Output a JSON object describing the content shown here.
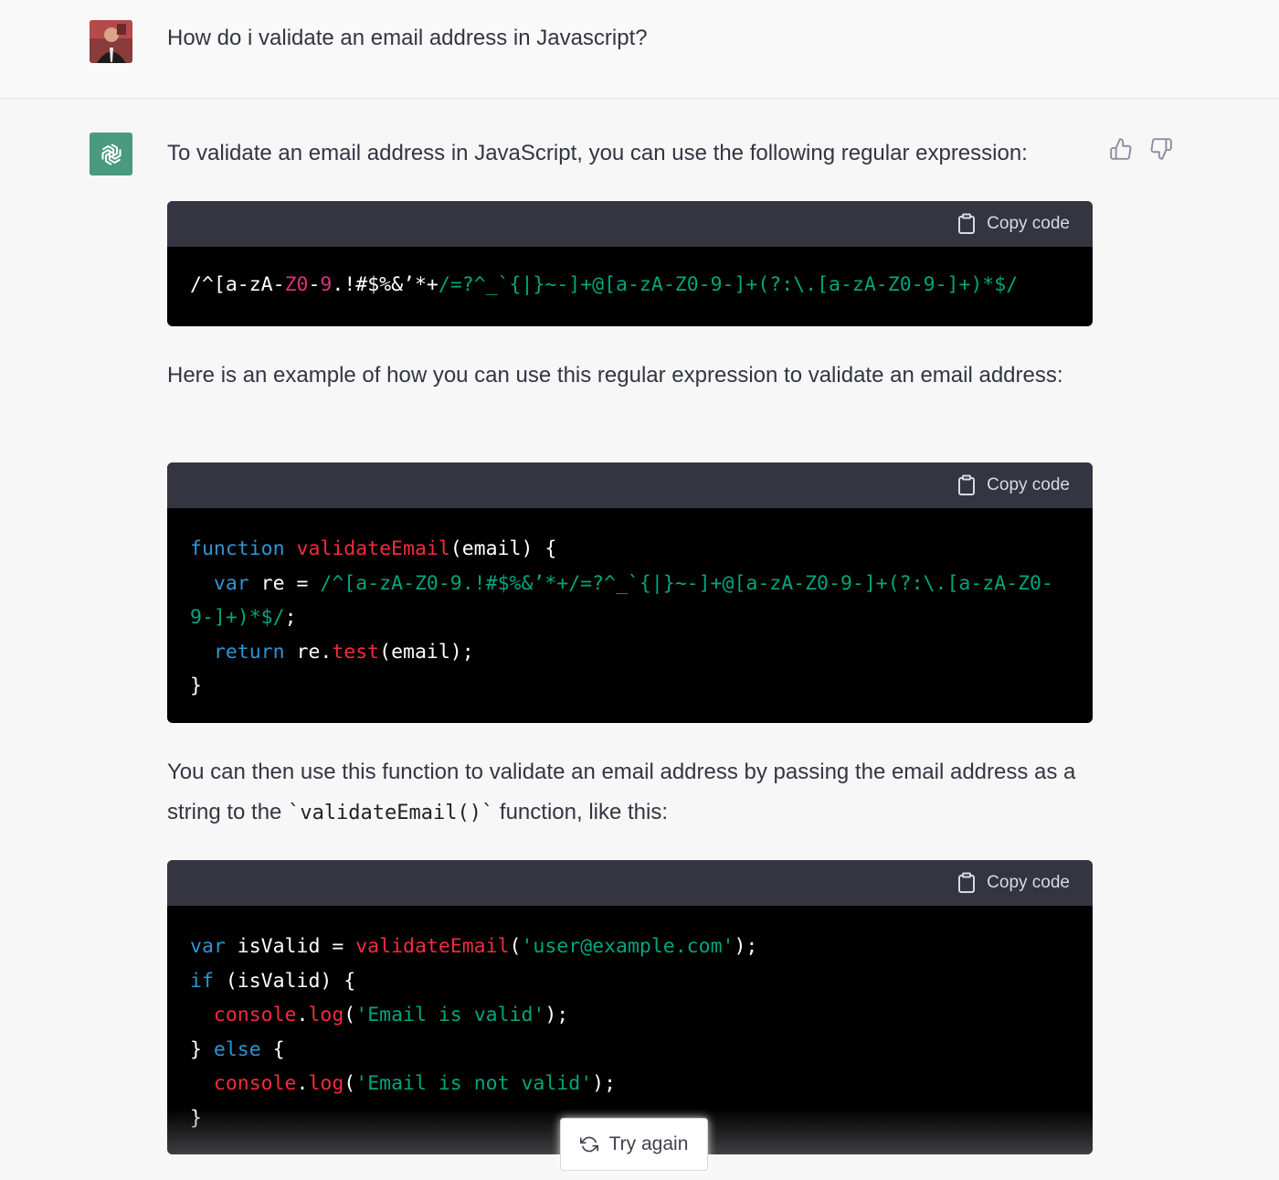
{
  "user_message": "How do i validate an email address in Javascript?",
  "assistant": {
    "intro": "To validate an email address in JavaScript, you can use the following regular expression:",
    "example_intro": "Here is an example of how you can use this regular expression to validate an email address:",
    "usage_intro_before": "You can then use this function to validate an email address by passing the email address as a string to the ",
    "usage_inline_code": "`validateEmail()`",
    "usage_intro_after": " function, like this:",
    "copy_label": "Copy code",
    "code_blocks": {
      "regex": {
        "lines": [
          [
            [
              "/^[a-zA-",
              "plain"
            ],
            [
              "Z0",
              "red"
            ],
            [
              "-",
              "plain"
            ],
            [
              "9",
              "red"
            ],
            [
              ".",
              "plain"
            ],
            [
              "!#$%&’*+",
              "plain"
            ],
            [
              "/=?^_`{|}~-]+@[a-zA-Z0-9-]+(?:\\.[a-zA-Z0-9-]+)*$/",
              "str"
            ]
          ]
        ]
      },
      "function": {
        "lines": [
          [
            [
              "function ",
              "kw"
            ],
            [
              "validateEmail",
              "fn"
            ],
            [
              "(email) {",
              "plain"
            ]
          ],
          [
            [
              "  var ",
              "kw"
            ],
            [
              "re = ",
              "plain"
            ],
            [
              "/^[a-zA-Z0-9.!#$%&’*+/=?^_`{|}~-]+@[a-zA-Z0-9-]+(?:\\.[a-zA-Z0-",
              "str"
            ]
          ],
          [
            [
              "9-]+)*$/",
              "str"
            ],
            [
              ";",
              "plain"
            ]
          ],
          [
            [
              "  return ",
              "kw"
            ],
            [
              "re.",
              "plain"
            ],
            [
              "test",
              "fn"
            ],
            [
              "(email);",
              "plain"
            ]
          ],
          [
            [
              "}",
              "plain"
            ]
          ]
        ]
      },
      "usage": {
        "lines": [
          [
            [
              "var ",
              "kw"
            ],
            [
              "isValid = ",
              "plain"
            ],
            [
              "validateEmail",
              "fn"
            ],
            [
              "(",
              "plain"
            ],
            [
              "'user@example.com'",
              "str"
            ],
            [
              ");",
              "plain"
            ]
          ],
          [
            [
              "if ",
              "kw"
            ],
            [
              "(isValid) {",
              "plain"
            ]
          ],
          [
            [
              "  console",
              "fn"
            ],
            [
              ".",
              "plain"
            ],
            [
              "log",
              "fn"
            ],
            [
              "(",
              "plain"
            ],
            [
              "'Email is valid'",
              "str"
            ],
            [
              ");",
              "plain"
            ]
          ],
          [
            [
              "} ",
              "plain"
            ],
            [
              "else ",
              "kw"
            ],
            [
              "{",
              "plain"
            ]
          ],
          [
            [
              "  console",
              "fn"
            ],
            [
              ".",
              "plain"
            ],
            [
              "log",
              "fn"
            ],
            [
              "(",
              "plain"
            ],
            [
              "'Email is not valid'",
              "str"
            ],
            [
              ");",
              "plain"
            ]
          ],
          [
            [
              "}",
              "plain"
            ]
          ]
        ]
      }
    }
  },
  "try_again_label": "Try again",
  "colors": {
    "assistant_avatar": "#4a9a7f",
    "code_header": "#343541",
    "keyword": "#2e95d3",
    "function": "#f22c3d",
    "string": "#00a67d"
  }
}
